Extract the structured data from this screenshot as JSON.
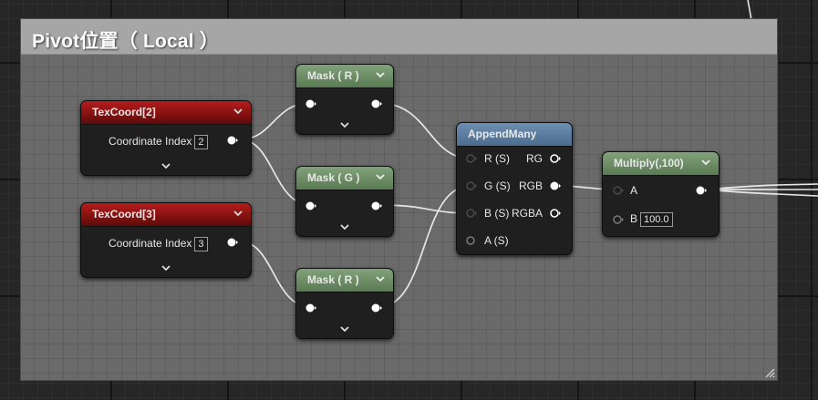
{
  "comment": {
    "title": "Pivot位置（ Local ）"
  },
  "nodes": {
    "texcoord2": {
      "title": "TexCoord[2]",
      "pin_label": "Coordinate Index",
      "value": "2"
    },
    "texcoord3": {
      "title": "TexCoord[3]",
      "pin_label": "Coordinate Index",
      "value": "3"
    },
    "mask_r_top": {
      "title": "Mask ( R )"
    },
    "mask_g": {
      "title": "Mask ( G )"
    },
    "mask_r_bottom": {
      "title": "Mask ( R )"
    },
    "appendmany": {
      "title": "AppendMany",
      "inputs": [
        "R (S)",
        "G (S)",
        "B (S)",
        "A (S)"
      ],
      "outputs": [
        "RG",
        "RGB",
        "RGBA"
      ]
    },
    "multiply": {
      "title": "Multiply(,100)",
      "input_a": "A",
      "input_b": "B",
      "b_value": "100.0"
    }
  },
  "icons": [
    "chevron-down-icon",
    "pin-icon",
    "resize-icon"
  ],
  "colors": {
    "comment_bg": "#6a6a6a",
    "comment_header": "#a6a6a6",
    "texcoord_header": "#9a1616",
    "mask_header": "#6d8f66",
    "append_header": "#5b7ea2",
    "wire": "#e6e6e6"
  }
}
